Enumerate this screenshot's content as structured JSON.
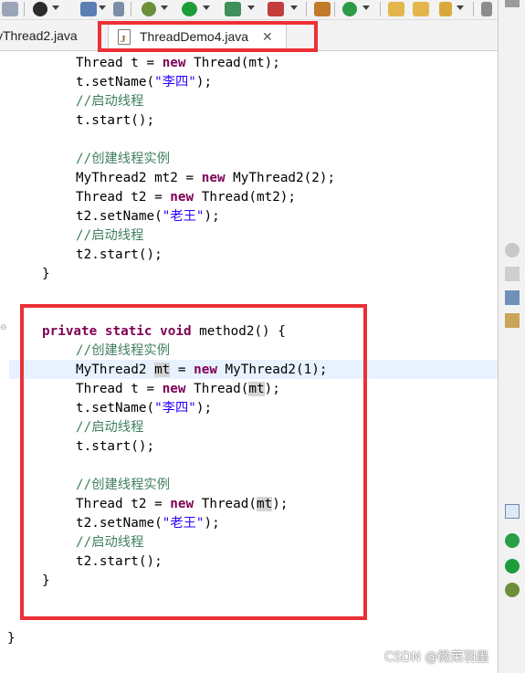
{
  "tabs": {
    "inactive_label": "yThread2.java",
    "active_label": "ThreadDemo4.java",
    "close_glyph": "✕"
  },
  "code": {
    "method1_tail": {
      "line1_type": "Thread",
      "line1_var": "t",
      "line1_new": "new",
      "line1_ctor": "Thread(mt);",
      "line2_pre": "t.setName(",
      "line2_str": "\"李四\"",
      "line2_post": ");",
      "line3_comment": "//启动线程",
      "line4": "t.start();",
      "line5_comment": "//创建线程实例",
      "line6_pre": "MyThread2 mt2 = ",
      "line6_new": "new",
      "line6_post": " MyThread2(2);",
      "line7_pre": "Thread t2 = ",
      "line7_new": "new",
      "line7_post": " Thread(mt2);",
      "line8_pre": "t2.setName(",
      "line8_str": "\"老王\"",
      "line8_post": ");",
      "line9_comment": "//启动线程",
      "line10": "t2.start();",
      "close_brace": "}"
    },
    "method2": {
      "kw_private": "private",
      "kw_static": "static",
      "kw_void": "void",
      "sig": " method2() {",
      "comment1": "//创建线程实例",
      "l2_pre": "MyThread2 ",
      "l2_var": "mt",
      "l2_eq": " = ",
      "l2_new": "new",
      "l2_post": " MyThread2(1);",
      "l3_pre": "Thread t = ",
      "l3_new": "new",
      "l3_mid": " Thread(",
      "l3_var": "mt",
      "l3_post": ");",
      "l4_pre": "t.setName(",
      "l4_str": "\"李四\"",
      "l4_post": ");",
      "comment2": "//启动线程",
      "l6": "t.start();",
      "comment3": "//创建线程实例",
      "l8_pre": "Thread t2 = ",
      "l8_new": "new",
      "l8_mid": " Thread(",
      "l8_var": "mt",
      "l8_post": ");",
      "l9_pre": "t2.setName(",
      "l9_str": "\"老王\"",
      "l9_post": ");",
      "comment4": "//启动线程",
      "l11": "t2.start();",
      "close_brace": "}"
    },
    "class_close": "}"
  },
  "watermark": "CSDN @微莱羽墨",
  "colors": {
    "keyword": "#7f0055",
    "comment": "#3f7f5f",
    "string": "#2a00ff",
    "highlight_box": "#ec3035",
    "current_line": "#e8f2fe"
  }
}
